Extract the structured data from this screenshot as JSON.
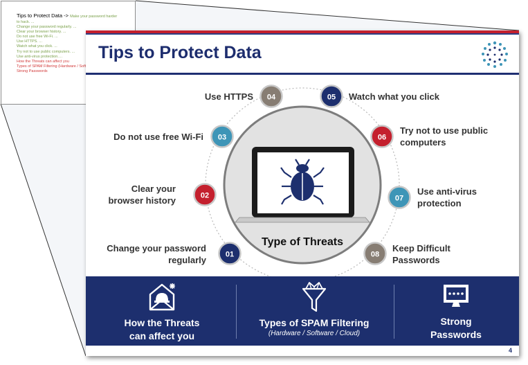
{
  "outline": {
    "title": "Tips to Protect Data ->",
    "title_suffix": "Make your password harder",
    "items": [
      {
        "text": "to hack. ...",
        "color": "#7aa04a"
      },
      {
        "text": "Change your password regularly. ...",
        "color": "#7aa04a"
      },
      {
        "text": "Clear your browser history. ...",
        "color": "#7aa04a"
      },
      {
        "text": "Do not use free Wi-Fi. ...",
        "color": "#7aa04a"
      },
      {
        "text": "Use HTTPS. ...",
        "color": "#7aa04a"
      },
      {
        "text": "Watch what you click. ...",
        "color": "#7aa04a"
      },
      {
        "text": "Try not to use public computers. ...",
        "color": "#7aa04a"
      },
      {
        "text": "Use anti-virus protection.…",
        "color": "#7aa04a"
      },
      {
        "text": "How the Threats can affect you",
        "color": "#d23b3b"
      },
      {
        "text": "Types of SPAM Filtering (Hardware / Software / Cloud)",
        "color": "#d23b3b"
      },
      {
        "text": "Strong Passwords",
        "color": "#d23b3b"
      }
    ]
  },
  "slide": {
    "title": "Tips to Protect Data",
    "center_label": "Type of Threats",
    "page_number": "4",
    "tips": {
      "n01": {
        "num": "01",
        "label1": "Change your password",
        "label2": "regularly"
      },
      "n02": {
        "num": "02",
        "label1": "Clear your",
        "label2": "browser history"
      },
      "n03": {
        "num": "03",
        "label1": "Do not use free Wi-Fi"
      },
      "n04": {
        "num": "04",
        "label1": "Use HTTPS"
      },
      "n05": {
        "num": "05",
        "label1": "Watch what you click"
      },
      "n06": {
        "num": "06",
        "label1": "Try not to use public",
        "label2": "computers"
      },
      "n07": {
        "num": "07",
        "label1": "Use anti-virus",
        "label2": "protection"
      },
      "n08": {
        "num": "08",
        "label1": "Keep Difficult",
        "label2": "Passwords"
      }
    },
    "banner": {
      "col1": {
        "line1": "How the Threats",
        "line2": "can affect you"
      },
      "col2": {
        "line1": "Types of SPAM Filtering",
        "sub": "(Hardware / Software / Cloud)"
      },
      "col3": {
        "line1": "Strong",
        "line2": "Passwords"
      }
    }
  },
  "colors": {
    "navy": "#1d2f6e",
    "red": "#c4202e",
    "teal": "#3e95b7",
    "gray": "#877d73",
    "green_text": "#7aa04a",
    "red_text": "#d23b3b"
  },
  "icons": [
    "logo-dots-icon",
    "bug-icon",
    "laptop-icon",
    "envelope-alert-icon",
    "funnel-filter-icon",
    "password-monitor-icon"
  ]
}
